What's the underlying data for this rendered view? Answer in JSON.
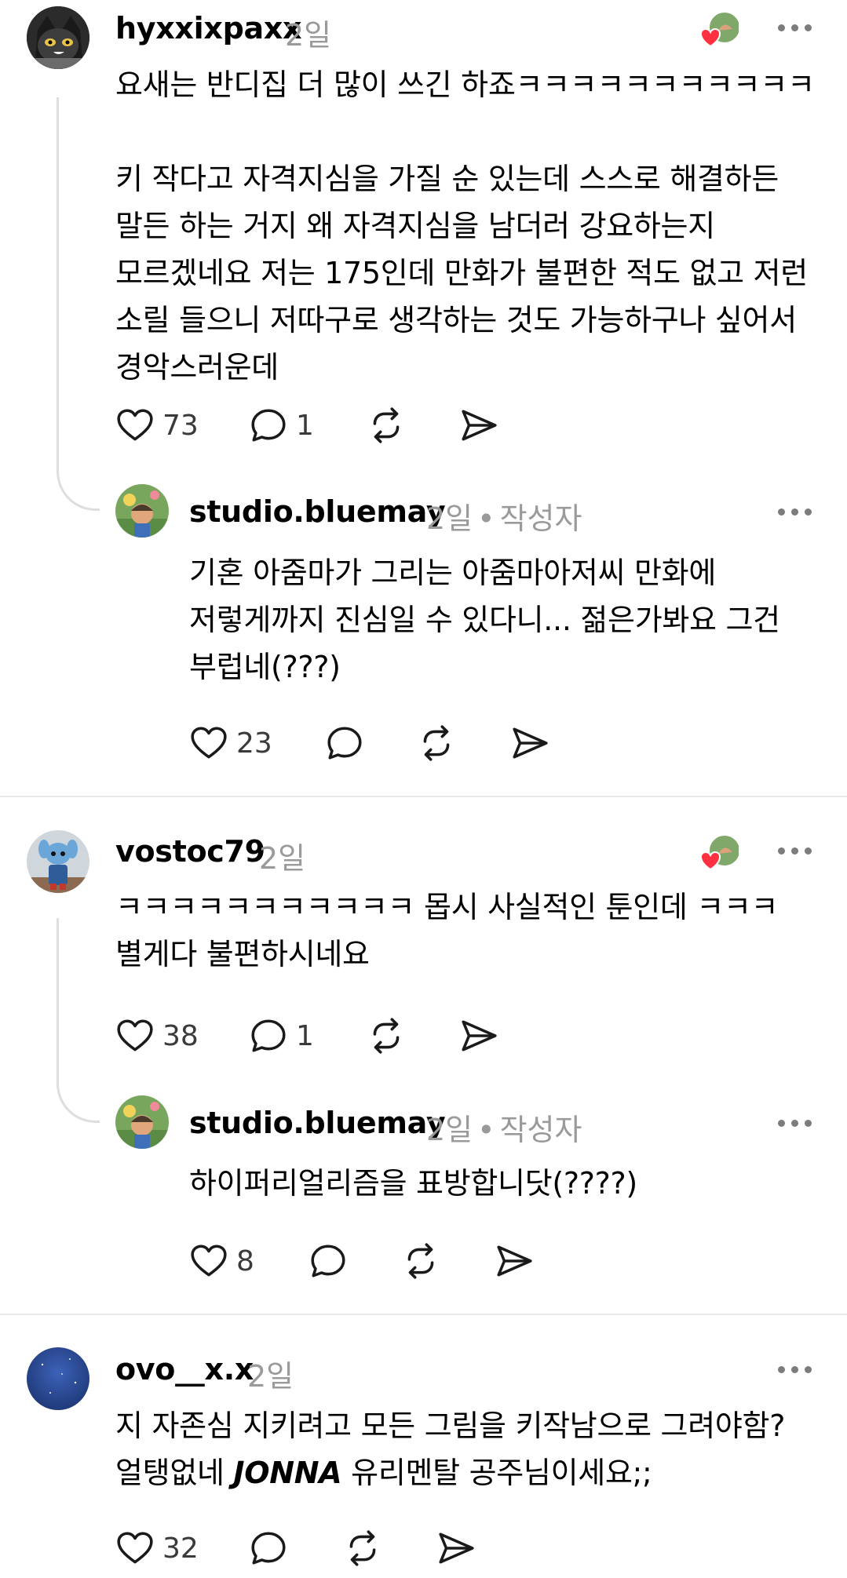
{
  "comments": [
    {
      "username": "hyxxixpaxx",
      "time": "2일",
      "text_lines": [
        "요새는 반디집 더 많이 쓰긴 하죠ㅋㅋㅋㅋㅋㅋㅋㅋㅋㅋㅋ"
      ],
      "text_lines_2": [
        "키 작다고 자격지심을 가질 순 있는데 스스로 해결하든",
        "말든 하는 거지 왜 자격지심을 남더러 강요하는지",
        "모르겠네요 저는 175인데 만화가 불편한 적도 없고 저런",
        "소릴 들으니 저따구로 생각하는 것도 가능하구나 싶어서",
        "경악스러운데"
      ],
      "likes": "73",
      "replies": "1",
      "reply": {
        "username": "studio.bluemay",
        "time": "2일",
        "badge": "작성자",
        "text_lines": [
          "기혼 아줌마가 그리는 아줌마아저씨 만화에",
          "저렇게까지 진심일 수 있다니... 젊은가봐요 그건",
          "부럽네(???)"
        ],
        "likes": "23"
      }
    },
    {
      "username": "vostoc79",
      "time": "2일",
      "text_lines": [
        "ㅋㅋㅋㅋㅋㅋㅋㅋㅋㅋㅋ 몹시 사실적인 툰인데 ㅋㅋㅋ",
        "별게다 불편하시네요"
      ],
      "likes": "38",
      "replies": "1",
      "reply": {
        "username": "studio.bluemay",
        "time": "2일",
        "badge": "작성자",
        "text_lines": [
          "하이퍼리얼리즘을 표방합니닷(????)"
        ],
        "likes": "8"
      }
    },
    {
      "username": "ovo__x.x",
      "time": "2일",
      "text_line_1": "지 자존심 지키려고 모든 그림을 키작남으로 그려야함?",
      "text_line_2_before": "얼탱없네 ",
      "text_line_2_emph": "JONNA",
      "text_line_2_after": " 유리멘탈 공주님이세요;;",
      "likes": "32"
    }
  ],
  "colors": {
    "meta_gray": "#9a9a9a",
    "heart_red": "#ff3040",
    "divider": "#e8e8e8"
  },
  "icons": [
    "heart-icon",
    "comment-icon",
    "repost-icon",
    "share-icon",
    "more-icon"
  ]
}
